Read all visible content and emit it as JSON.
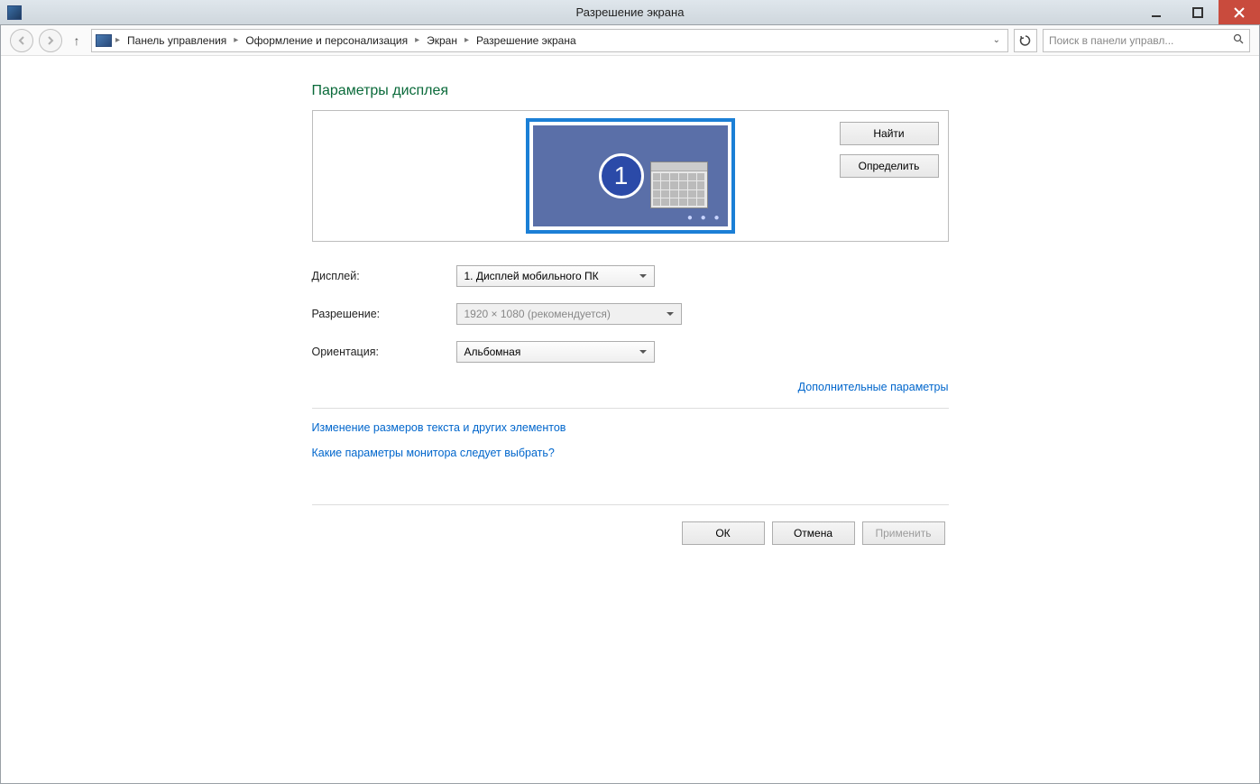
{
  "window": {
    "title": "Разрешение экрана"
  },
  "breadcrumb": {
    "items": [
      "Панель управления",
      "Оформление и персонализация",
      "Экран",
      "Разрешение экрана"
    ]
  },
  "search": {
    "placeholder": "Поиск в панели управл..."
  },
  "heading": "Параметры дисплея",
  "preview": {
    "monitor_number": "1",
    "detect_label": "Найти",
    "identify_label": "Определить"
  },
  "form": {
    "display_label": "Дисплей:",
    "display_value": "1. Дисплей мобильного ПК",
    "resolution_label": "Разрешение:",
    "resolution_value": "1920 × 1080 (рекомендуется)",
    "orientation_label": "Ориентация:",
    "orientation_value": "Альбомная"
  },
  "links": {
    "advanced": "Дополнительные параметры",
    "text_size": "Изменение размеров текста и других элементов",
    "help": "Какие параметры монитора следует выбрать?"
  },
  "buttons": {
    "ok": "ОК",
    "cancel": "Отмена",
    "apply": "Применить"
  }
}
